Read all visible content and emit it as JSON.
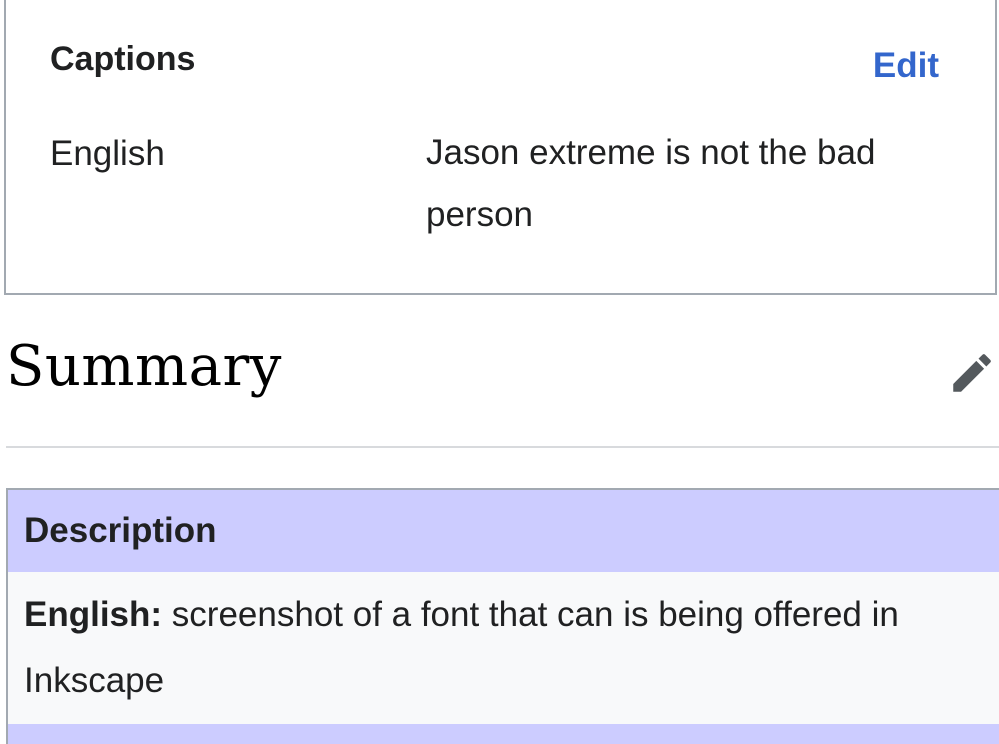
{
  "captions": {
    "title": "Captions",
    "edit_label": "Edit",
    "language": "English",
    "text": "Jason extreme is not the bad person"
  },
  "summary": {
    "heading": "Summary",
    "edit_icon": "pencil-icon"
  },
  "description": {
    "header": "Description",
    "language_label": "English:",
    "text": "screenshot of a font that can is being offered in Inkscape"
  },
  "colors": {
    "link": "#3366cc",
    "table_header": "#ccccff",
    "table_body": "#f8f9fa",
    "border": "#a2a9b1"
  }
}
